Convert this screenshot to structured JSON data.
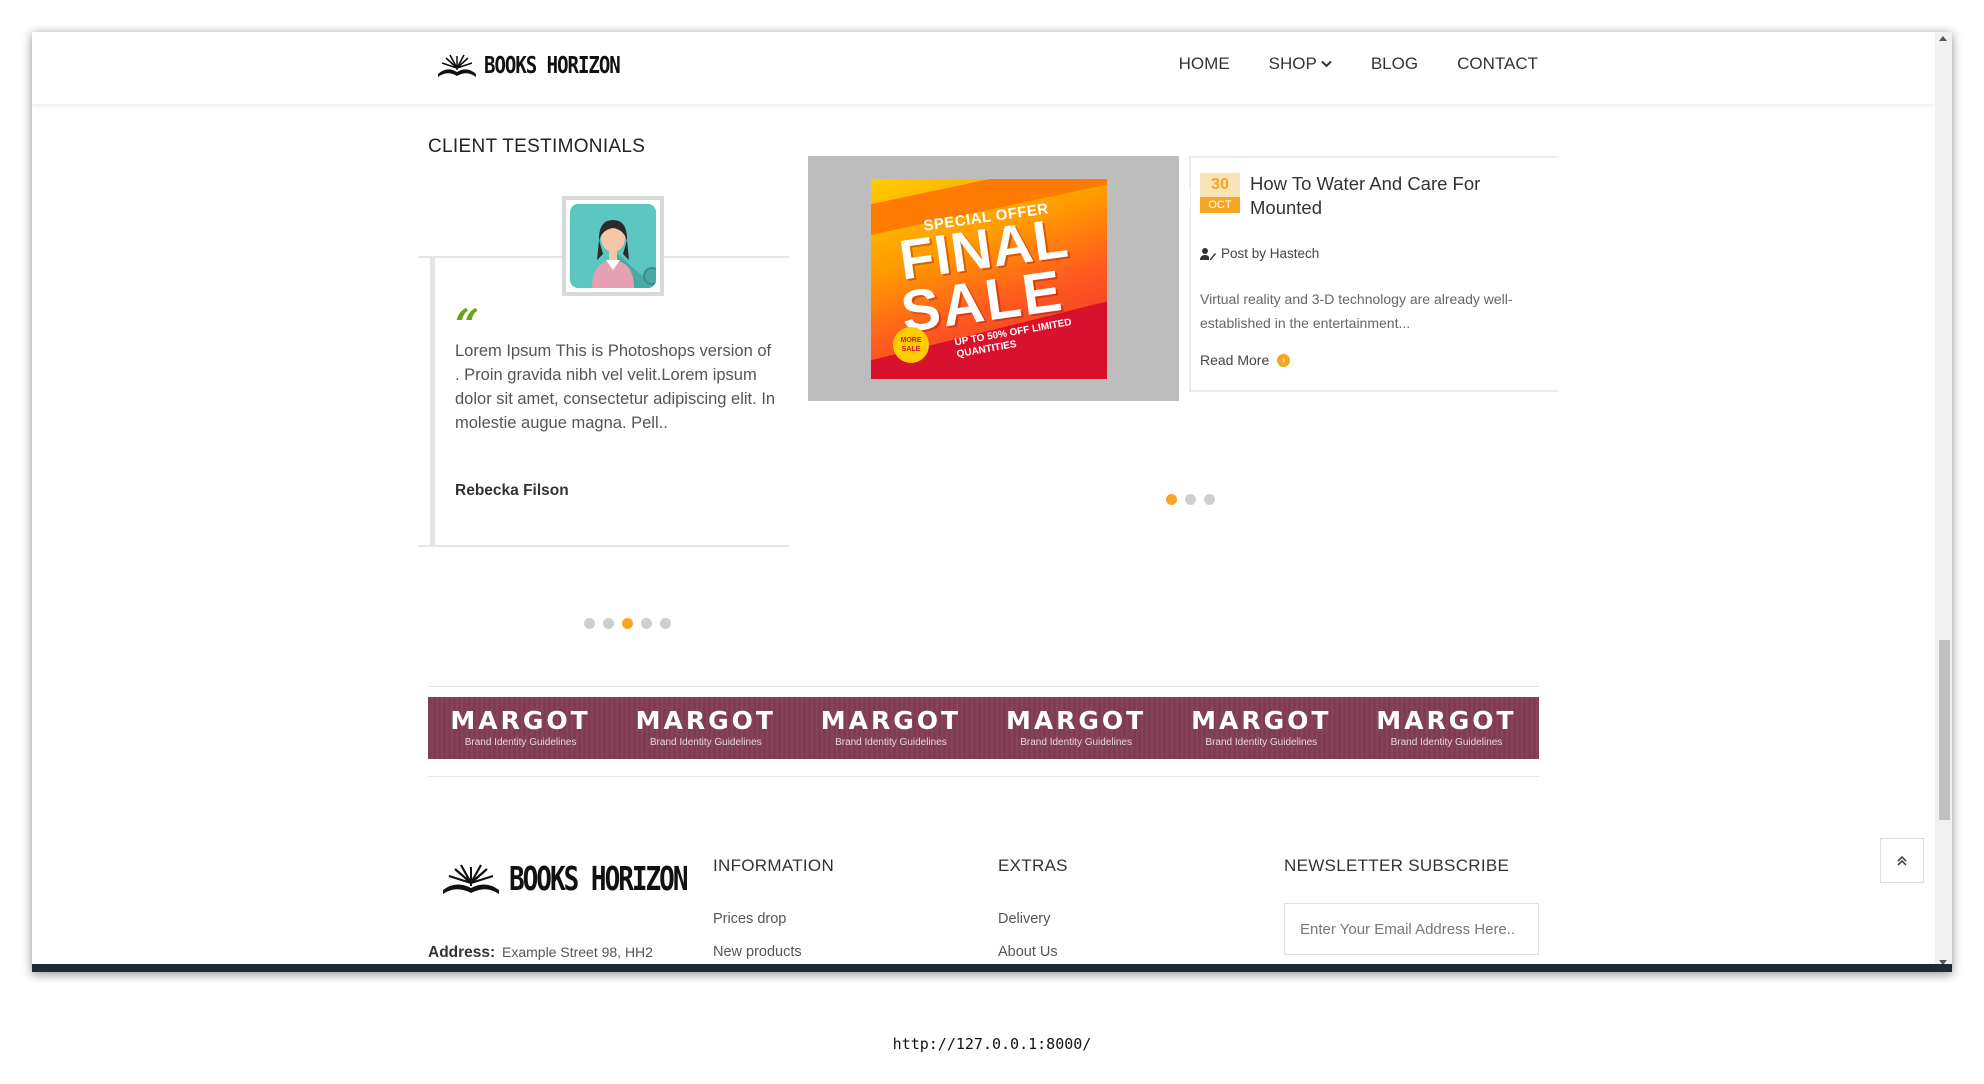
{
  "header": {
    "logo_text": "BOOKS HORIZON",
    "nav": [
      "HOME",
      "SHOP",
      "BLOG",
      "CONTACT"
    ]
  },
  "testimonials": {
    "title": "CLIENT TESTIMONIALS",
    "quote_mark": "“",
    "text": "Lorem Ipsum This is Photoshops version of . Proin gravida nibh vel velit.Lorem ipsum dolor sit amet, consectetur adipiscing elit. In molestie augue magna. Pell..",
    "author": "Rebecka Filson",
    "dots": 5,
    "active_dot": 3
  },
  "blog": {
    "image": {
      "special": "SPECIAL OFFER",
      "final": "FINAL",
      "sale": "SALE",
      "badge": "MORE SALE",
      "upto": "UP TO 50% OFF LIMITED QUANTITIES"
    },
    "day": "30",
    "month": "OCT",
    "title": "How To Water And Care For Mounted",
    "author": "Post by Hastech",
    "excerpt": "Virtual reality and 3-D technology are already well-established in the entertainment...",
    "read_more": "Read More",
    "dots": 3,
    "active_dot": 1
  },
  "brands": {
    "name": "MARGOT",
    "subtitle": "Brand Identity Guidelines",
    "count": 6
  },
  "footer": {
    "logo_text": "BOOKS HORIZON",
    "address_label": "Address:",
    "address_value": "Example Street 98, HH2",
    "information": {
      "title": "INFORMATION",
      "links": [
        "Prices drop",
        "New products"
      ]
    },
    "extras": {
      "title": "EXTRAS",
      "links": [
        "Delivery",
        "About Us"
      ]
    },
    "newsletter": {
      "title": "NEWSLETTER SUBSCRIBE",
      "placeholder": "Enter Your Email Address Here.."
    }
  },
  "status_url": "http://127.0.0.1:8000/",
  "colors": {
    "accent": "#f5a623",
    "quote_green": "#6aa515",
    "brand_strip": "#7f3c52"
  }
}
